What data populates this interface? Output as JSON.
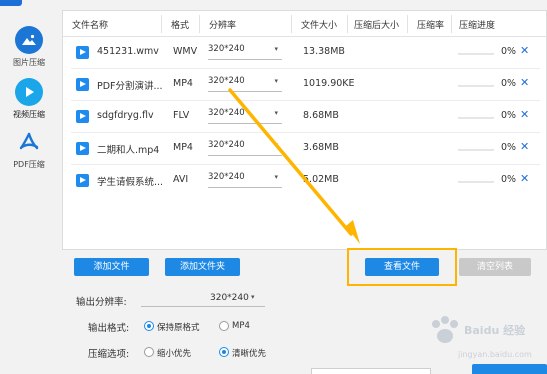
{
  "sidebar": {
    "items": [
      {
        "label": "图片压缩",
        "icon": "image-icon"
      },
      {
        "label": "视频压缩",
        "icon": "play-icon"
      },
      {
        "label": "PDF压缩",
        "icon": "pdf-icon"
      }
    ]
  },
  "table": {
    "headers": [
      "文件名称",
      "格式",
      "分辨率",
      "文件大小",
      "压缩后大小",
      "压缩率",
      "压缩进度"
    ],
    "rows": [
      {
        "name": "451231.wmv",
        "format": "WMV",
        "resolution": "320*240",
        "size": "13.38MB",
        "progress": 0,
        "progress_text": "0%"
      },
      {
        "name": "PDF分割演讲...",
        "format": "MP4",
        "resolution": "320*240",
        "size": "1019.90KE",
        "progress": 0,
        "progress_text": "0%"
      },
      {
        "name": "sdgfdryg.flv",
        "format": "FLV",
        "resolution": "320*240",
        "size": "8.68MB",
        "progress": 0,
        "progress_text": "0%"
      },
      {
        "name": "二期和人.mp4",
        "format": "MP4",
        "resolution": "320*240",
        "size": "3.68MB",
        "progress": 0,
        "progress_text": "0%"
      },
      {
        "name": "学生请假系统...",
        "format": "AVI",
        "resolution": "320*240",
        "size": "5.02MB",
        "progress": 0,
        "progress_text": "0%"
      }
    ]
  },
  "buttons": {
    "add_file": "添加文件",
    "add_folder": "添加文件夹",
    "view_file": "查看文件",
    "clear_list": "清空列表"
  },
  "settings": {
    "output_resolution_label": "输出分辨率:",
    "output_resolution_value": "320*240",
    "output_format_label": "输出格式:",
    "format_options": [
      "保持原格式",
      "MP4"
    ],
    "format_selected": "保持原格式",
    "compress_label": "压缩选项:",
    "compress_options": [
      "缩小优先",
      "清晰优先"
    ],
    "compress_selected": "清晰优先"
  },
  "watermark": {
    "line1": "Baidu 经验",
    "line2": "jingyan.baidu.com"
  },
  "colors": {
    "accent": "#1e88e5",
    "highlight": "#ffb400",
    "disabled": "#c9c9c9"
  }
}
